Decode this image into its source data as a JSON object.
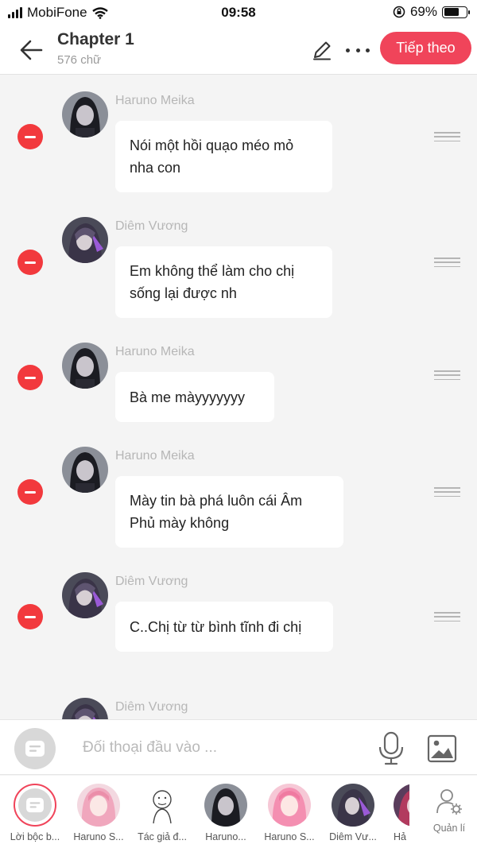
{
  "status_bar": {
    "carrier": "MobiFone",
    "time": "09:58",
    "battery": "69%",
    "battery_level": 0.69
  },
  "header": {
    "title": "Chapter 1",
    "word_count": "576 chữ",
    "next_label": "Tiếp theo"
  },
  "messages": [
    {
      "name": "Haruno Meika",
      "text": "Nói một hồi quạo méo mỏ nha con",
      "avatar": "dark-hair-girl-avatar"
    },
    {
      "name": "Diêm Vương",
      "text": "Em không thể làm cho chị sống lại được nh",
      "avatar": "purple-hair-man-avatar"
    },
    {
      "name": "Haruno Meika",
      "text": "Bà me màyyyyyyy",
      "avatar": "dark-hair-girl-avatar"
    },
    {
      "name": "Haruno Meika",
      "text": "Mày tin bà phá luôn cái Âm Phủ mày không",
      "avatar": "dark-hair-girl-avatar"
    },
    {
      "name": "Diêm Vương",
      "text": "C..Chị từ từ bình tĩnh đi chị",
      "avatar": "purple-hair-man-avatar"
    },
    {
      "name": "Diêm Vương",
      "text": "",
      "avatar": "purple-hair-man-avatar"
    }
  ],
  "input": {
    "placeholder": "Đối thoại đầu vào ..."
  },
  "characters": [
    {
      "label": "Lời bộc b...",
      "icon": "narration-icon"
    },
    {
      "label": "Haruno S...",
      "icon": "pink-hair-girl-avatar"
    },
    {
      "label": "Tác giả đ...",
      "icon": "author-sketch-avatar"
    },
    {
      "label": "Haruno...",
      "icon": "dark-hair-girl-avatar"
    },
    {
      "label": "Haruno S...",
      "icon": "pink-hair-girl-avatar"
    },
    {
      "label": "Diêm Vư...",
      "icon": "purple-hair-man-avatar"
    },
    {
      "label": "Hả",
      "icon": "red-hair-avatar"
    }
  ],
  "manage_label": "Quản lí",
  "colors": {
    "accent": "#f0445a",
    "delete": "#f2393d",
    "background": "#f4f4f4"
  }
}
